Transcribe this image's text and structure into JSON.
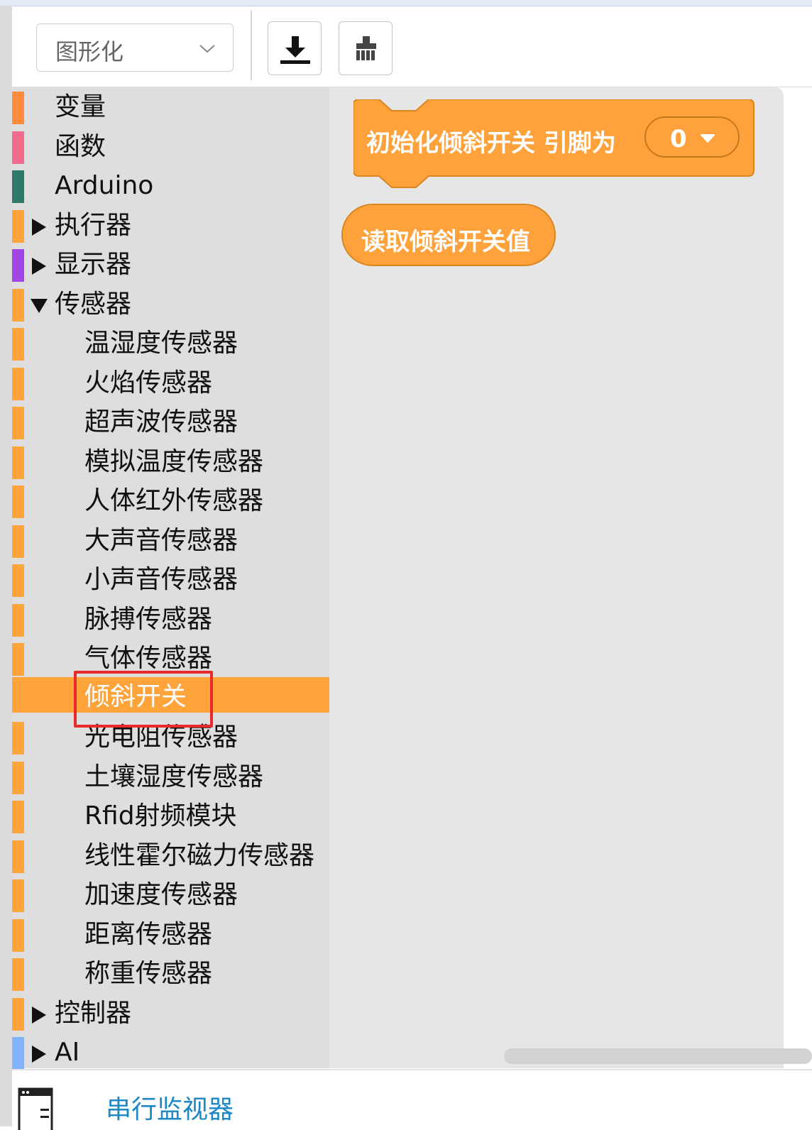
{
  "toolbar": {
    "mode_select_value": "图形化",
    "download_icon": "download-icon",
    "clear_icon": "broom-icon"
  },
  "sidebar": {
    "categories": [
      {
        "label": "变量",
        "color": "#ff8c3a",
        "arrow": ""
      },
      {
        "label": "函数",
        "color": "#f26b8a",
        "arrow": ""
      },
      {
        "label": "Arduino",
        "color": "#2e7a6a",
        "arrow": ""
      },
      {
        "label": "执行器",
        "color": "#ffa33b",
        "arrow": "collapsed"
      },
      {
        "label": "显示器",
        "color": "#a346e8",
        "arrow": "collapsed"
      },
      {
        "label": "传感器",
        "color": "#ffa33b",
        "arrow": "expanded"
      },
      {
        "label": "温湿度传感器",
        "color": "#ffa33b",
        "arrow": ""
      },
      {
        "label": "火焰传感器",
        "color": "#ffa33b",
        "arrow": ""
      },
      {
        "label": "超声波传感器",
        "color": "#ffa33b",
        "arrow": ""
      },
      {
        "label": "模拟温度传感器",
        "color": "#ffa33b",
        "arrow": ""
      },
      {
        "label": "人体红外传感器",
        "color": "#ffa33b",
        "arrow": ""
      },
      {
        "label": "大声音传感器",
        "color": "#ffa33b",
        "arrow": ""
      },
      {
        "label": "小声音传感器",
        "color": "#ffa33b",
        "arrow": ""
      },
      {
        "label": "脉搏传感器",
        "color": "#ffa33b",
        "arrow": ""
      },
      {
        "label": "气体传感器",
        "color": "#ffa33b",
        "arrow": ""
      },
      {
        "label": "倾斜开关",
        "color": "#ffa33b",
        "arrow": "",
        "selected": true
      },
      {
        "label": "光电阻传感器",
        "color": "#ffa33b",
        "arrow": ""
      },
      {
        "label": "土壤湿度传感器",
        "color": "#ffa33b",
        "arrow": ""
      },
      {
        "label": "Rfid射频模块",
        "color": "#ffa33b",
        "arrow": ""
      },
      {
        "label": "线性霍尔磁力传感器",
        "color": "#ffa33b",
        "arrow": ""
      },
      {
        "label": "加速度传感器",
        "color": "#ffa33b",
        "arrow": ""
      },
      {
        "label": "距离传感器",
        "color": "#ffa33b",
        "arrow": ""
      },
      {
        "label": "称重传感器",
        "color": "#ffa33b",
        "arrow": ""
      },
      {
        "label": "控制器",
        "color": "#ffa33b",
        "arrow": "collapsed"
      },
      {
        "label": "AI",
        "color": "#7fb2ff",
        "arrow": "collapsed"
      }
    ]
  },
  "blocks": {
    "init_label": "初始化倾斜开关 引脚为",
    "init_pin_value": "0",
    "read_label": "读取倾斜开关值",
    "color": "#ffa23b"
  },
  "bottom": {
    "monitor_label": "串行监视器",
    "monitor_icon": "window-icon"
  }
}
